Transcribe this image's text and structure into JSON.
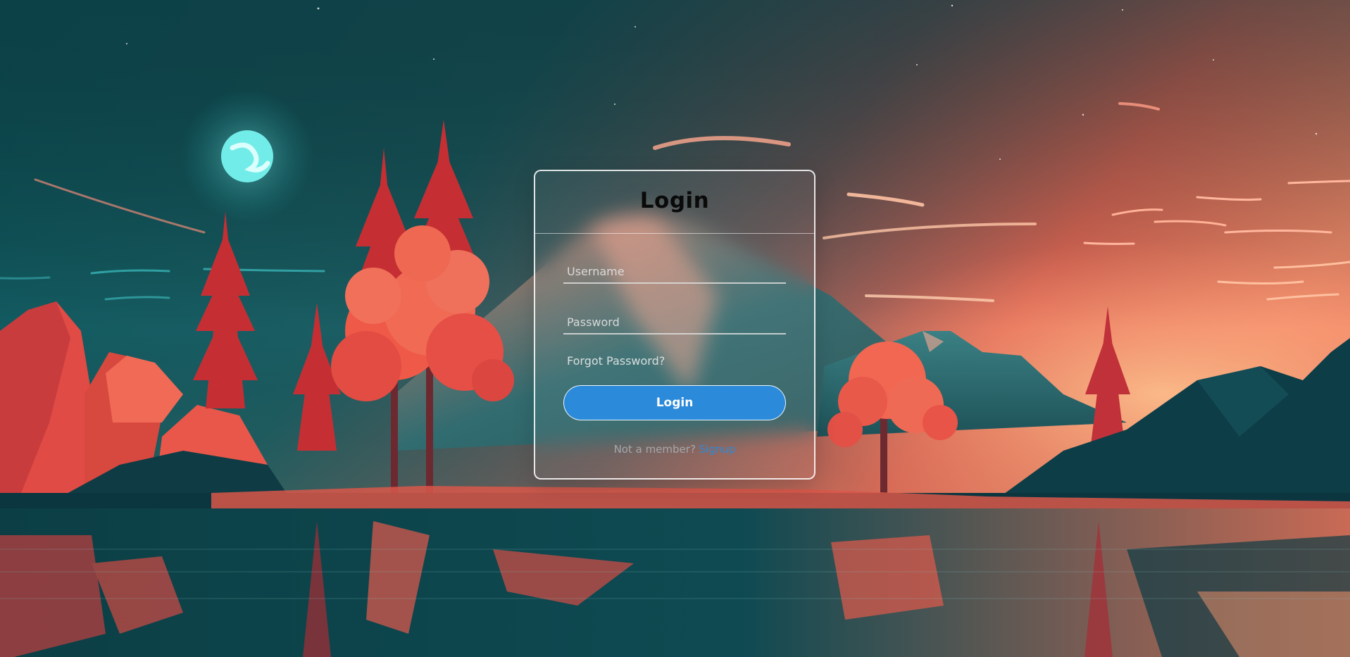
{
  "background": {
    "description_icon": "landscape-illustration",
    "colors": {
      "sky_left": "#0f5f63",
      "sky_right": "#f07860",
      "horizon_glow": "#fbb88f",
      "moon": "#7ef3f0",
      "tree_red": "#e24a43",
      "mountain_dark": "#0b3c44",
      "water": "#0d4a50"
    }
  },
  "login": {
    "title": "Login",
    "username_placeholder": "Username",
    "password_placeholder": "Password",
    "forgot_password": "Forgot Password?",
    "submit_label": "Login",
    "signup_prompt": "Not a member?",
    "signup_link": "Signup"
  },
  "colors": {
    "button": "#2b8ad9",
    "link": "#2b8ad9",
    "title": "#0a0a0a"
  }
}
